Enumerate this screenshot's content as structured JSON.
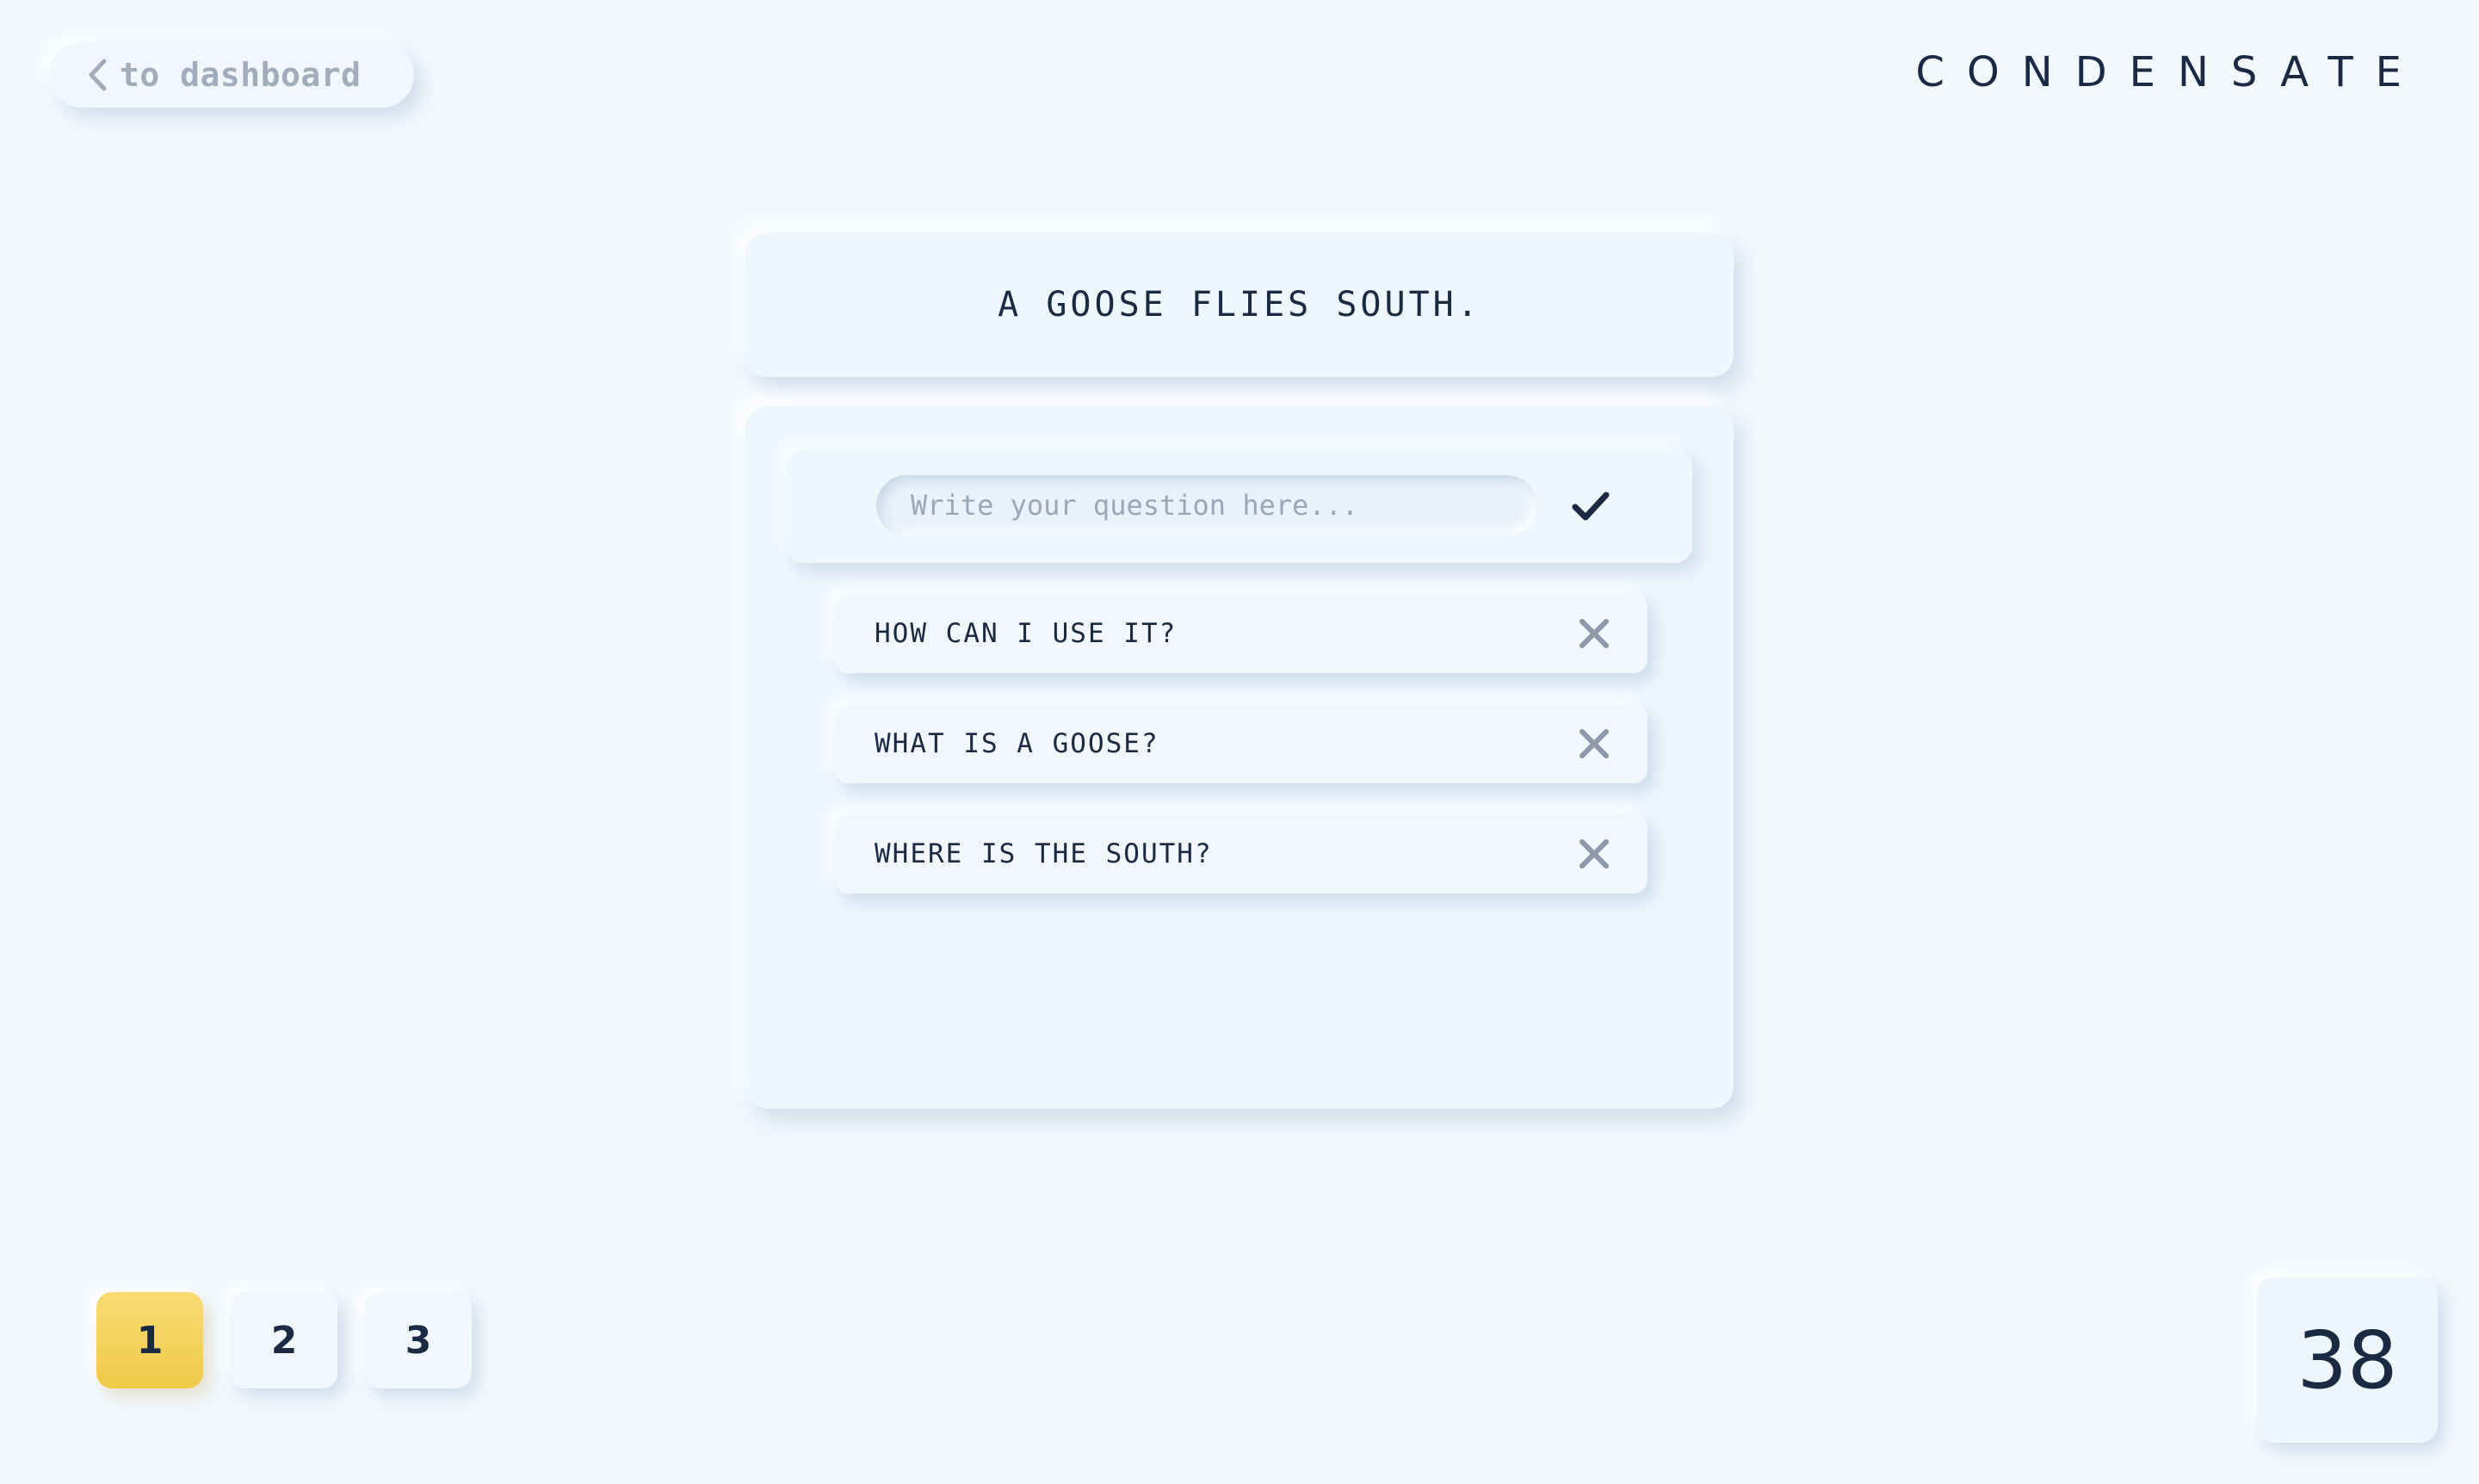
{
  "header": {
    "back_label": "to dashboard",
    "brand": "CONDENSATE"
  },
  "statement": {
    "text": "A GOOSE FLIES SOUTH."
  },
  "question_input": {
    "placeholder": "Write your question here...",
    "value": ""
  },
  "questions": [
    {
      "text": "HOW CAN I USE IT?"
    },
    {
      "text": "WHAT IS A GOOSE?"
    },
    {
      "text": "WHERE IS THE SOUTH?"
    }
  ],
  "pagination": {
    "pages": [
      "1",
      "2",
      "3"
    ],
    "active": "1"
  },
  "counter": {
    "value": "38"
  },
  "icons": {
    "back": "chevron-left-icon",
    "submit": "check-icon",
    "remove": "close-icon"
  },
  "colors": {
    "background": "#f3f8fd",
    "text": "#1a2a42",
    "muted": "#a1adbb",
    "active_page": "#f5d35c",
    "remove_icon": "#8e99a8"
  }
}
